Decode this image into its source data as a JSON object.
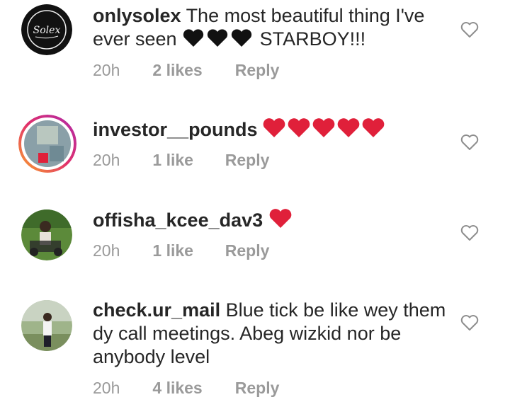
{
  "comments": [
    {
      "username": "onlysolex",
      "text": "The most beautiful thing I've ever seen",
      "emoji_after_text": "black-heart x3",
      "text_tail": "STARBOY!!!",
      "time": "20h",
      "likes": "2 likes",
      "reply": "Reply",
      "avatar_logo_text": "Solex"
    },
    {
      "username": "investor__pounds",
      "text": "",
      "emoji": "red-heart x5",
      "time": "20h",
      "likes": "1 like",
      "reply": "Reply"
    },
    {
      "username": "offisha_kcee_dav3",
      "text": "",
      "emoji": "red-heart x1",
      "time": "20h",
      "likes": "1 like",
      "reply": "Reply"
    },
    {
      "username": "check.ur_mail",
      "text": "Blue tick be like wey them dy call meetings. Abeg wizkid nor be anybody  level",
      "time": "20h",
      "likes": "4 likes",
      "reply": "Reply"
    }
  ],
  "colors": {
    "text": "#262626",
    "meta": "#9a9a9a",
    "heart_red": "#e0203a",
    "black_heart": "#111111"
  }
}
